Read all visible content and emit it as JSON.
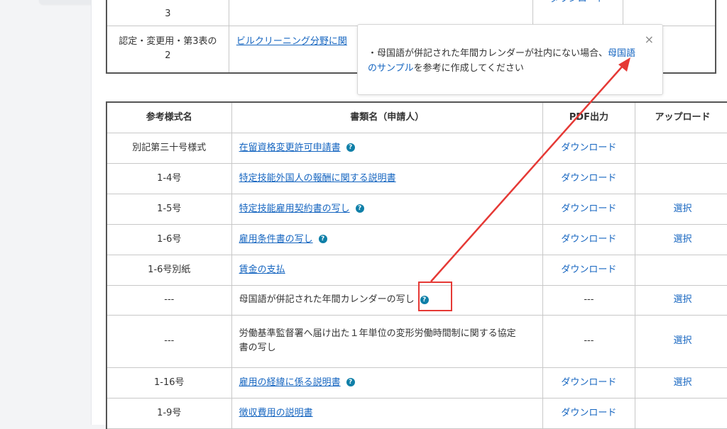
{
  "top_table": {
    "rows": [
      {
        "ref": "3",
        "doc": "",
        "pdf": "ダウンロード"
      },
      {
        "ref": "認定・変更用・第3表の2",
        "ref_line1": "認定・変更用・第3表の",
        "ref_line2": "2",
        "doc": "ビルクリーニング分野に関"
      }
    ]
  },
  "popup": {
    "text_prefix": "・母国語が併記された年間カレンダーが社内にない場合、",
    "link_text": "母国語のサンプル",
    "link_line1": "母国語",
    "link_line2": "のサンプル",
    "text_suffix": "を参考に作成してください",
    "close": "×"
  },
  "table": {
    "headers": [
      "参考様式名",
      "書類名（申請人）",
      "PDF出力",
      "アップロード"
    ],
    "rows": [
      {
        "ref": "別記第三十号様式",
        "doc": "在留資格変更許可申請書",
        "doc_link": true,
        "help": true,
        "pdf": "ダウンロード",
        "upload": ""
      },
      {
        "ref": "1-4号",
        "doc": "特定技能外国人の報酬に関する説明書",
        "doc_link": true,
        "help": false,
        "pdf": "ダウンロード",
        "upload": ""
      },
      {
        "ref": "1-5号",
        "doc": "特定技能雇用契約書の写し",
        "doc_link": true,
        "help": true,
        "pdf": "ダウンロード",
        "upload": "選択"
      },
      {
        "ref": "1-6号",
        "doc": "雇用条件書の写し",
        "doc_link": true,
        "help": true,
        "pdf": "ダウンロード",
        "upload": "選択"
      },
      {
        "ref": "1-6号別紙",
        "doc": "賃金の支払",
        "doc_link": true,
        "help": false,
        "pdf": "ダウンロード",
        "upload": ""
      },
      {
        "ref": "---",
        "doc": "母国語が併記された年間カレンダーの写し",
        "doc_link": false,
        "help": true,
        "pdf": "---",
        "upload": "選択"
      },
      {
        "ref": "---",
        "doc": "労働基準監督署へ届け出た１年単位の変形労働時間制に関する協定書の写し",
        "doc_line1": "労働基準監督署へ届け出た１年単位の変形労働時間制に関する協定",
        "doc_line2": "書の写し",
        "doc_link": false,
        "help": false,
        "pdf": "---",
        "upload": "選択"
      },
      {
        "ref": "1-16号",
        "doc": "雇用の経緯に係る説明書",
        "doc_link": true,
        "help": true,
        "pdf": "ダウンロード",
        "upload": "選択"
      },
      {
        "ref": "1-9号",
        "doc": "徴収費用の説明書",
        "doc_link": true,
        "help": false,
        "pdf": "ダウンロード",
        "upload": ""
      }
    ]
  },
  "help_icon": "question-circle-icon",
  "colors": {
    "link": "#1565c0",
    "help_icon": "#0f7fa8",
    "annotation": "#e53935"
  }
}
